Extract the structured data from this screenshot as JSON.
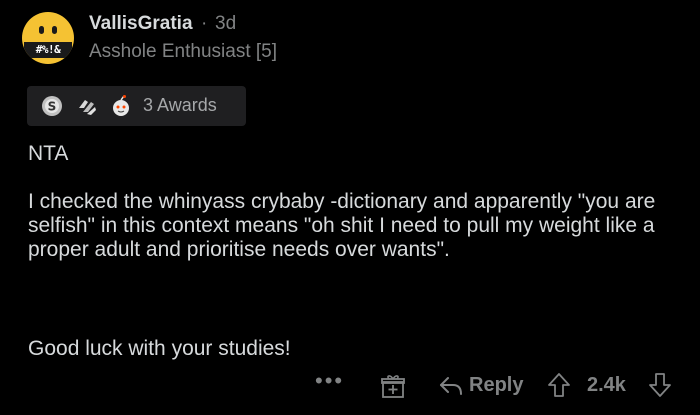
{
  "comment": {
    "author": "VallisGratia",
    "separator": "·",
    "age": "3d",
    "flair": "Asshole Enthusiast [5]",
    "avatar_text": "#%!&",
    "awards": {
      "label": "3 Awards",
      "icons": [
        "silver-award-icon",
        "wholesome-hands-award-icon",
        "snoo-award-icon"
      ]
    },
    "paragraphs": [
      "NTA",
      "I checked the whinyass crybaby -dictionary and apparently \"you are selfish\" in this context means \"oh shit I need to pull my weight like a proper adult and prioritise needs over wants\".",
      "Good luck with your studies!"
    ]
  },
  "actions": {
    "more": "•••",
    "reply_label": "Reply",
    "score": "2.4k",
    "icons": [
      "more-options-icon",
      "gift-award-icon",
      "reply-arrow-icon",
      "upvote-icon",
      "downvote-icon"
    ]
  },
  "colors": {
    "background": "#000000",
    "avatar": "#f5c233",
    "text": "#d7dadc",
    "muted": "#818384",
    "awards_bg": "#1f1f21"
  }
}
